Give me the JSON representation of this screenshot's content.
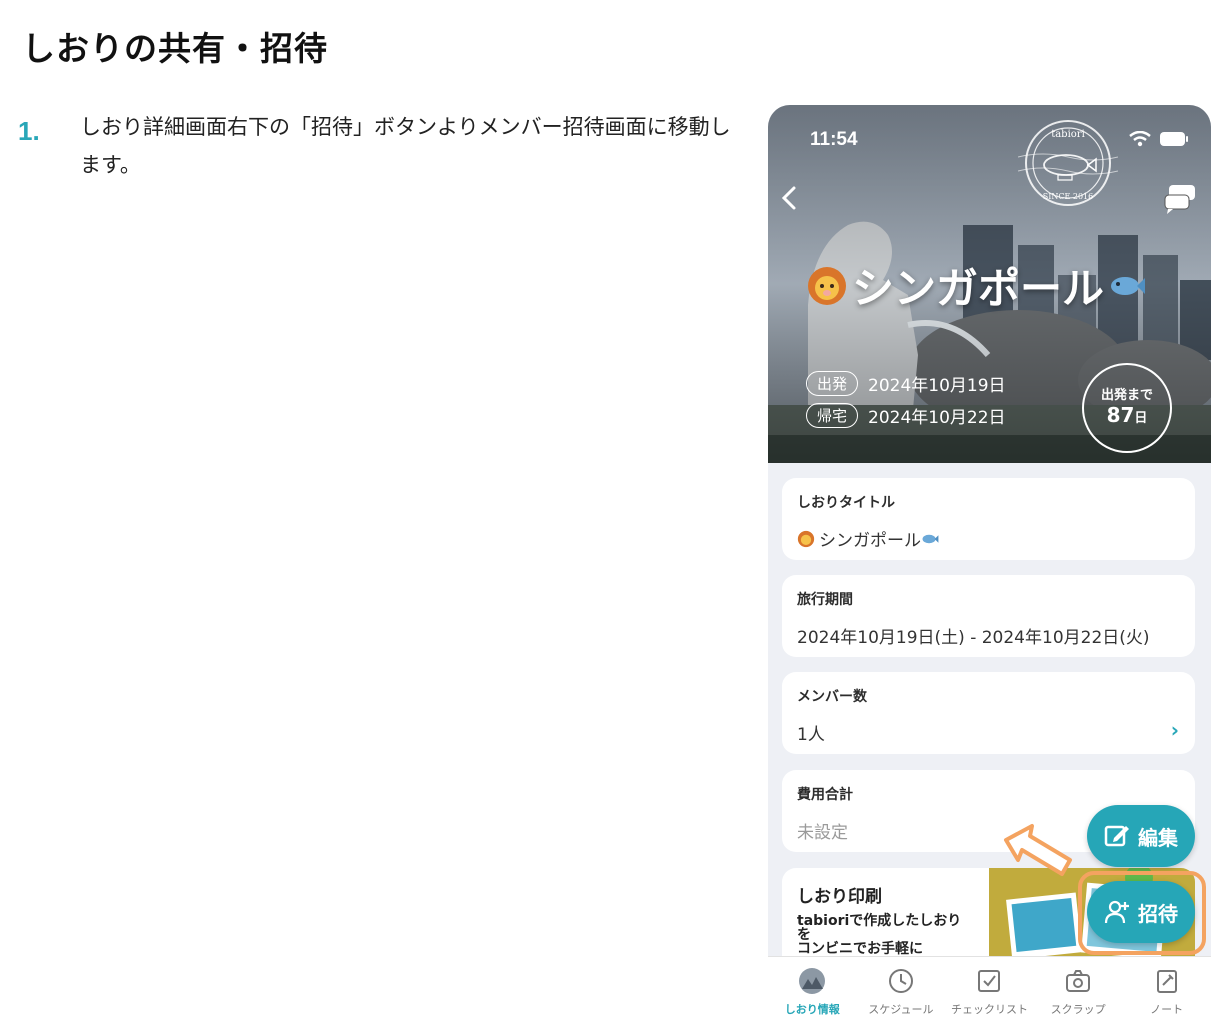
{
  "page": {
    "heading": "しおりの共有・招待"
  },
  "step": {
    "number": "1.",
    "text": "しおり詳細画面右下の「招待」ボタンよりメンバー招待画面に移動します。"
  },
  "phone": {
    "status_time": "11:54",
    "stamp_text_top": "tabiori",
    "stamp_text_bottom": "SINCE 2016",
    "trip_title": "シンガポール",
    "departure_label": "出発",
    "departure_date": "2024年10月19日",
    "return_label": "帰宅",
    "return_date": "2024年10月22日",
    "countdown_label": "出発まで",
    "countdown_days": "87",
    "countdown_unit": "日",
    "cards": {
      "title": {
        "label": "しおりタイトル",
        "value": "シンガポール"
      },
      "period": {
        "label": "旅行期間",
        "value": "2024年10月19日(土) - 2024年10月22日(火)"
      },
      "members": {
        "label": "メンバー数",
        "value": "1人"
      },
      "cost": {
        "label": "費用合計",
        "value": "未設定"
      }
    },
    "print": {
      "title": "しおり印刷",
      "desc_line1": "tabioriで作成したしおり",
      "desc_line2": "を",
      "desc_line3": "コンビニでお手軽に"
    },
    "fab_edit": "編集",
    "fab_invite": "招待",
    "tabs": [
      {
        "label": "しおり情報",
        "icon": "trip-photo-icon",
        "active": true
      },
      {
        "label": "スケジュール",
        "icon": "clock-icon",
        "active": false
      },
      {
        "label": "チェックリスト",
        "icon": "checkbox-icon",
        "active": false
      },
      {
        "label": "スクラップ",
        "icon": "camera-icon",
        "active": false
      },
      {
        "label": "ノート",
        "icon": "note-icon",
        "active": false
      }
    ],
    "colors": {
      "accent": "#26a6b7",
      "highlight": "#f4a360"
    }
  }
}
